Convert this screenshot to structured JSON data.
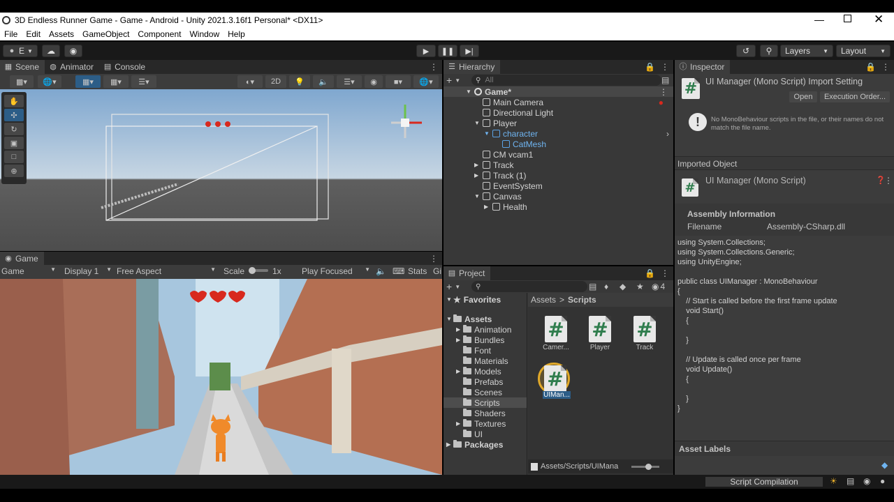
{
  "window": {
    "title": "3D Endless Runner Game - Game - Android - Unity 2021.3.16f1 Personal* <DX11>"
  },
  "menu": [
    "File",
    "Edit",
    "Assets",
    "GameObject",
    "Component",
    "Window",
    "Help"
  ],
  "toolbar": {
    "account_label": "E",
    "layers_label": "Layers",
    "layout_label": "Layout"
  },
  "scene_tabs": [
    "Scene",
    "Animator",
    "Console"
  ],
  "scene_toolbar": {
    "mode_2d": "2D"
  },
  "game_panel": {
    "tab": "Game",
    "display_mode": "Game",
    "display": "Display 1",
    "aspect": "Free Aspect",
    "scale_label": "Scale",
    "scale_value": "1x",
    "play_focused": "Play Focused",
    "stats": "Stats",
    "gizmos": "Gi"
  },
  "hierarchy": {
    "tab": "Hierarchy",
    "search_placeholder": "All",
    "items": [
      {
        "label": "Game*"
      },
      {
        "label": "Main Camera"
      },
      {
        "label": "Directional Light"
      },
      {
        "label": "Player"
      },
      {
        "label": "character"
      },
      {
        "label": "CatMesh"
      },
      {
        "label": "CM vcam1"
      },
      {
        "label": "Track"
      },
      {
        "label": "Track (1)"
      },
      {
        "label": "EventSystem"
      },
      {
        "label": "Canvas"
      },
      {
        "label": "Health"
      }
    ]
  },
  "project": {
    "tab": "Project",
    "hidden_count": "4",
    "favorites": "Favorites",
    "assets": "Assets",
    "folders": [
      "Animation",
      "Bundles",
      "Font",
      "Materials",
      "Models",
      "Prefabs",
      "Scenes",
      "Scripts",
      "Shaders",
      "Textures",
      "UI"
    ],
    "packages": "Packages",
    "breadcrumb_root": "Assets",
    "breadcrumb_sep": ">",
    "breadcrumb_leaf": "Scripts",
    "files": [
      "Camer...",
      "Player",
      "Track",
      "UIMan..."
    ],
    "status_path": "Assets/Scripts/UIMana"
  },
  "inspector": {
    "tab": "Inspector",
    "header_title": "UI Manager (Mono Script) Import Setting",
    "open_button": "Open",
    "execution_order_button": "Execution Order...",
    "warning": "No MonoBehaviour scripts in the file, or their names do not match the file name.",
    "imported_object": "Imported Object",
    "object_title": "UI Manager (Mono Script)",
    "assembly_title": "Assembly Information",
    "filename_label": "Filename",
    "filename_value": "Assembly-CSharp.dll",
    "code": [
      "using System.Collections;",
      "using System.Collections.Generic;",
      "using UnityEngine;",
      "",
      "public class UIManager : MonoBehaviour",
      "{",
      "    // Start is called before the first frame update",
      "    void Start()",
      "    {",
      "",
      "    }",
      "",
      "    // Update is called once per frame",
      "    void Update()",
      "    {",
      "",
      "    }",
      "}"
    ],
    "asset_labels": "Asset Labels"
  },
  "statusbar": {
    "label": "Script Compilation"
  },
  "colors": {
    "accent_blue": "#2c5d87",
    "heart_red": "#d8291e",
    "script_green": "#2f7d4d"
  }
}
